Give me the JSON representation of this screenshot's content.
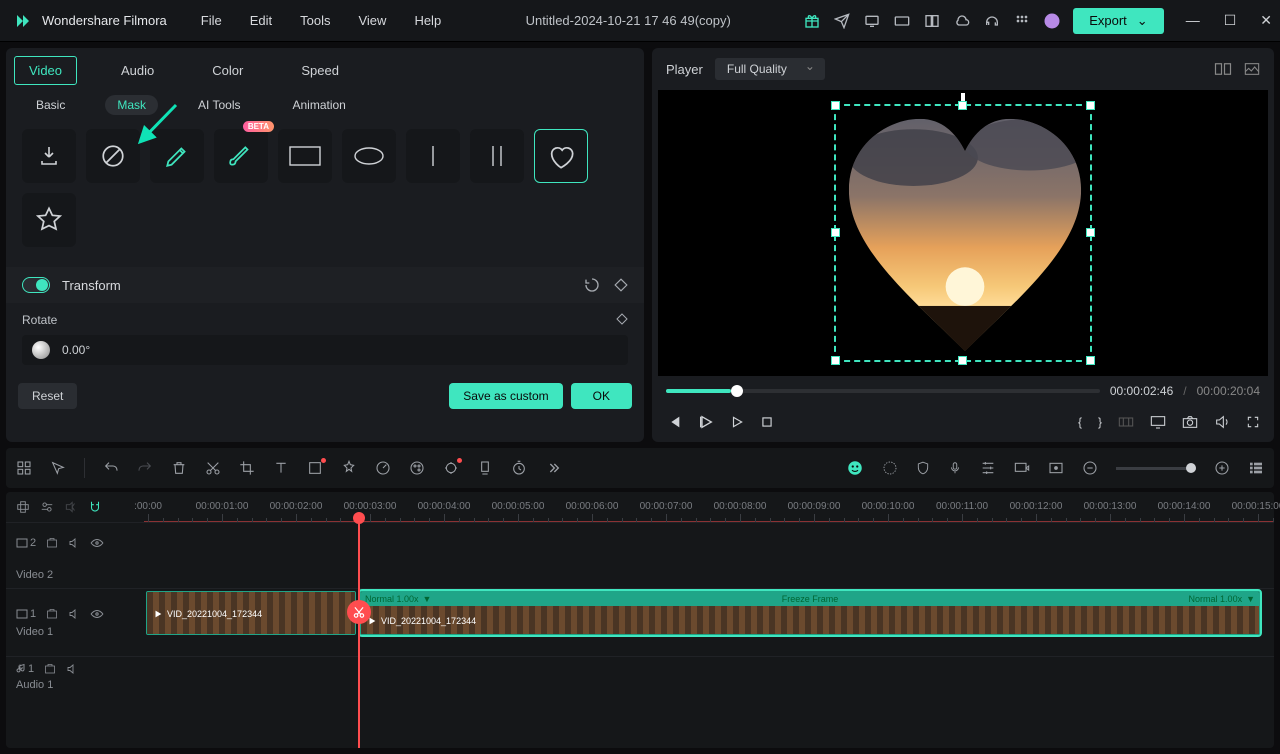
{
  "app": {
    "name": "Wondershare Filmora",
    "document_title": "Untitled-2024-10-21 17 46 49(copy)"
  },
  "menubar": [
    "File",
    "Edit",
    "Tools",
    "View",
    "Help"
  ],
  "export_label": "Export",
  "left_panel": {
    "top_tabs": [
      "Video",
      "Audio",
      "Color",
      "Speed"
    ],
    "active_top": "Video",
    "sub_tabs": [
      "Basic",
      "Mask",
      "AI Tools",
      "Animation"
    ],
    "active_sub": "Mask",
    "beta_label": "BETA",
    "transform": {
      "title": "Transform"
    },
    "rotate": {
      "label": "Rotate",
      "value": "0.00°"
    },
    "buttons": {
      "reset": "Reset",
      "save": "Save as custom",
      "ok": "OK"
    }
  },
  "player": {
    "label": "Player",
    "quality": "Full Quality",
    "current_time": "00:00:02:46",
    "total_time": "00:00:20:04",
    "separator": "/"
  },
  "timeline": {
    "ruler": [
      ":00:00",
      "00:00:01:00",
      "00:00:02:00",
      "00:00:03:00",
      "00:00:04:00",
      "00:00:05:00",
      "00:00:06:00",
      "00:00:07:00",
      "00:00:08:00",
      "00:00:09:00",
      "00:00:10:00",
      "00:00:11:00",
      "00:00:12:00",
      "00:00:13:00",
      "00:00:14:00",
      "00:00:15:00"
    ],
    "tracks": {
      "video2": {
        "icon_label": "2",
        "label": "Video 2"
      },
      "video1": {
        "icon_label": "1",
        "label": "Video 1"
      },
      "audio1": {
        "icon_label": "1",
        "label": "Audio 1"
      }
    },
    "clip1_name": "VID_20221004_172344",
    "clip2": {
      "top": "Normal 1.00x",
      "freeze": "Freeze Frame",
      "top_right": "Normal 1.00x",
      "name": "VID_20221004_172344"
    }
  }
}
